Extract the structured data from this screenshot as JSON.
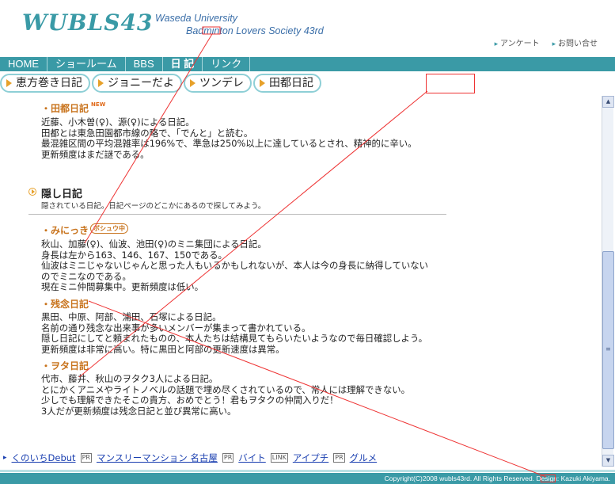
{
  "header": {
    "logo": "WUBLS43",
    "subtitle_line1": "Waseda University",
    "subtitle_line2": "Badminton Lovers Society 43rd",
    "links": [
      "アンケート",
      "お問い合せ"
    ]
  },
  "nav": {
    "items": [
      {
        "label": "HOME"
      },
      {
        "label": "ショールーム"
      },
      {
        "label": "BBS"
      },
      {
        "label": "日 記"
      },
      {
        "label": "リンク"
      }
    ]
  },
  "subtabs": [
    {
      "label": "恵方巻き日記"
    },
    {
      "label": "ジョニーだよ"
    },
    {
      "label": "ツンデレ"
    },
    {
      "label": "田都日記"
    }
  ],
  "diaries": {
    "tato": {
      "title": "・田都日記",
      "badge": "NEW",
      "lines": [
        "近藤、小木曽(♀)、源(♀)による日記。",
        "田都とは東急田園都市線の略で、「でんと」と読む。",
        "最混雑区間の平均混雑率は196%で、準急は250%以上に達しているとされ、精神的に辛い。",
        "更新頻度はまだ謎である。"
      ]
    },
    "secret": {
      "title": "隠し日記",
      "desc": "隠されている日記。日記ページのどこかにあるので探してみよう。"
    },
    "minikki": {
      "title": "・みにっき",
      "badge": "ボシュウ中",
      "lines": [
        "秋山、加藤(♀)、仙波、池田(♀)のミニ集団による日記。",
        "身長は左から163、146、167、150である。",
        "仙波はミニじゃないじゃんと思った人もいるかもしれないが、本人は今の身長に納得していない",
        "のでミニなのである。",
        "現在ミニ仲間募集中。更新頻度は低い。"
      ]
    },
    "zannen": {
      "title": "・残念日記",
      "lines": [
        "黒田、中原、阿部、浦田、石塚による日記。",
        "名前の通り残念な出来事が多いメンバーが集まって書かれている。",
        "隠し日記にしてと頼まれたものの、本人たちは結構見てもらいたいようなので毎日確認しよう。",
        "更新頻度は非常に高い。特に黒田と阿部の更新速度は異常。"
      ]
    },
    "otaku": {
      "title": "・ヲタ日記",
      "lines": [
        "代市、藤井、秋山のヲタク3人による日記。",
        "とにかくアニメやライトノベルの話題で埋め尽くされているので、常人には理解できない。",
        "少しでも理解できたそこの貴方、おめでとう！君もヲタクの仲間入りだ！",
        "3人だが更新頻度は残念日記と並び異常に高い。"
      ]
    }
  },
  "footer_links": {
    "link1": "くのいちDebut",
    "pr_tag": "PR",
    "link2": "マンスリーマンション 名古屋",
    "link3": "バイト",
    "link_tag": "LINK",
    "link4": "アイプチ",
    "link5": "グルメ"
  },
  "copyright": "Copyright(C)2008 wubls43rd. All Rights Reserved. Design: Kazuki Akiyama.",
  "colors": {
    "teal": "#3a9aa6",
    "orange": "#c8731c",
    "link": "#1a3fb0",
    "annotation": "#e33333"
  }
}
